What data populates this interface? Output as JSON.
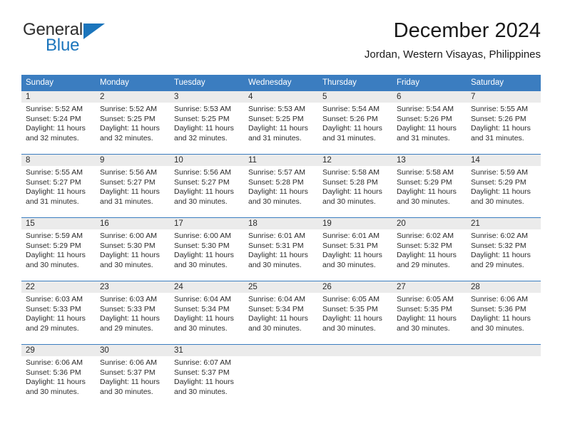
{
  "brand": {
    "name_part1": "General",
    "name_part2": "Blue",
    "accent_color": "#1b75bc"
  },
  "header": {
    "month_title": "December 2024",
    "location": "Jordan, Western Visayas, Philippines"
  },
  "calendar": {
    "header_bg": "#3b7dc0",
    "daynum_band_bg": "#ebebeb",
    "weekday_headers": [
      "Sunday",
      "Monday",
      "Tuesday",
      "Wednesday",
      "Thursday",
      "Friday",
      "Saturday"
    ],
    "weeks": [
      [
        {
          "day": "1",
          "sunrise": "Sunrise: 5:52 AM",
          "sunset": "Sunset: 5:24 PM",
          "daylight_line1": "Daylight: 11 hours",
          "daylight_line2": "and 32 minutes."
        },
        {
          "day": "2",
          "sunrise": "Sunrise: 5:52 AM",
          "sunset": "Sunset: 5:25 PM",
          "daylight_line1": "Daylight: 11 hours",
          "daylight_line2": "and 32 minutes."
        },
        {
          "day": "3",
          "sunrise": "Sunrise: 5:53 AM",
          "sunset": "Sunset: 5:25 PM",
          "daylight_line1": "Daylight: 11 hours",
          "daylight_line2": "and 32 minutes."
        },
        {
          "day": "4",
          "sunrise": "Sunrise: 5:53 AM",
          "sunset": "Sunset: 5:25 PM",
          "daylight_line1": "Daylight: 11 hours",
          "daylight_line2": "and 31 minutes."
        },
        {
          "day": "5",
          "sunrise": "Sunrise: 5:54 AM",
          "sunset": "Sunset: 5:26 PM",
          "daylight_line1": "Daylight: 11 hours",
          "daylight_line2": "and 31 minutes."
        },
        {
          "day": "6",
          "sunrise": "Sunrise: 5:54 AM",
          "sunset": "Sunset: 5:26 PM",
          "daylight_line1": "Daylight: 11 hours",
          "daylight_line2": "and 31 minutes."
        },
        {
          "day": "7",
          "sunrise": "Sunrise: 5:55 AM",
          "sunset": "Sunset: 5:26 PM",
          "daylight_line1": "Daylight: 11 hours",
          "daylight_line2": "and 31 minutes."
        }
      ],
      [
        {
          "day": "8",
          "sunrise": "Sunrise: 5:55 AM",
          "sunset": "Sunset: 5:27 PM",
          "daylight_line1": "Daylight: 11 hours",
          "daylight_line2": "and 31 minutes."
        },
        {
          "day": "9",
          "sunrise": "Sunrise: 5:56 AM",
          "sunset": "Sunset: 5:27 PM",
          "daylight_line1": "Daylight: 11 hours",
          "daylight_line2": "and 31 minutes."
        },
        {
          "day": "10",
          "sunrise": "Sunrise: 5:56 AM",
          "sunset": "Sunset: 5:27 PM",
          "daylight_line1": "Daylight: 11 hours",
          "daylight_line2": "and 30 minutes."
        },
        {
          "day": "11",
          "sunrise": "Sunrise: 5:57 AM",
          "sunset": "Sunset: 5:28 PM",
          "daylight_line1": "Daylight: 11 hours",
          "daylight_line2": "and 30 minutes."
        },
        {
          "day": "12",
          "sunrise": "Sunrise: 5:58 AM",
          "sunset": "Sunset: 5:28 PM",
          "daylight_line1": "Daylight: 11 hours",
          "daylight_line2": "and 30 minutes."
        },
        {
          "day": "13",
          "sunrise": "Sunrise: 5:58 AM",
          "sunset": "Sunset: 5:29 PM",
          "daylight_line1": "Daylight: 11 hours",
          "daylight_line2": "and 30 minutes."
        },
        {
          "day": "14",
          "sunrise": "Sunrise: 5:59 AM",
          "sunset": "Sunset: 5:29 PM",
          "daylight_line1": "Daylight: 11 hours",
          "daylight_line2": "and 30 minutes."
        }
      ],
      [
        {
          "day": "15",
          "sunrise": "Sunrise: 5:59 AM",
          "sunset": "Sunset: 5:29 PM",
          "daylight_line1": "Daylight: 11 hours",
          "daylight_line2": "and 30 minutes."
        },
        {
          "day": "16",
          "sunrise": "Sunrise: 6:00 AM",
          "sunset": "Sunset: 5:30 PM",
          "daylight_line1": "Daylight: 11 hours",
          "daylight_line2": "and 30 minutes."
        },
        {
          "day": "17",
          "sunrise": "Sunrise: 6:00 AM",
          "sunset": "Sunset: 5:30 PM",
          "daylight_line1": "Daylight: 11 hours",
          "daylight_line2": "and 30 minutes."
        },
        {
          "day": "18",
          "sunrise": "Sunrise: 6:01 AM",
          "sunset": "Sunset: 5:31 PM",
          "daylight_line1": "Daylight: 11 hours",
          "daylight_line2": "and 30 minutes."
        },
        {
          "day": "19",
          "sunrise": "Sunrise: 6:01 AM",
          "sunset": "Sunset: 5:31 PM",
          "daylight_line1": "Daylight: 11 hours",
          "daylight_line2": "and 30 minutes."
        },
        {
          "day": "20",
          "sunrise": "Sunrise: 6:02 AM",
          "sunset": "Sunset: 5:32 PM",
          "daylight_line1": "Daylight: 11 hours",
          "daylight_line2": "and 29 minutes."
        },
        {
          "day": "21",
          "sunrise": "Sunrise: 6:02 AM",
          "sunset": "Sunset: 5:32 PM",
          "daylight_line1": "Daylight: 11 hours",
          "daylight_line2": "and 29 minutes."
        }
      ],
      [
        {
          "day": "22",
          "sunrise": "Sunrise: 6:03 AM",
          "sunset": "Sunset: 5:33 PM",
          "daylight_line1": "Daylight: 11 hours",
          "daylight_line2": "and 29 minutes."
        },
        {
          "day": "23",
          "sunrise": "Sunrise: 6:03 AM",
          "sunset": "Sunset: 5:33 PM",
          "daylight_line1": "Daylight: 11 hours",
          "daylight_line2": "and 29 minutes."
        },
        {
          "day": "24",
          "sunrise": "Sunrise: 6:04 AM",
          "sunset": "Sunset: 5:34 PM",
          "daylight_line1": "Daylight: 11 hours",
          "daylight_line2": "and 30 minutes."
        },
        {
          "day": "25",
          "sunrise": "Sunrise: 6:04 AM",
          "sunset": "Sunset: 5:34 PM",
          "daylight_line1": "Daylight: 11 hours",
          "daylight_line2": "and 30 minutes."
        },
        {
          "day": "26",
          "sunrise": "Sunrise: 6:05 AM",
          "sunset": "Sunset: 5:35 PM",
          "daylight_line1": "Daylight: 11 hours",
          "daylight_line2": "and 30 minutes."
        },
        {
          "day": "27",
          "sunrise": "Sunrise: 6:05 AM",
          "sunset": "Sunset: 5:35 PM",
          "daylight_line1": "Daylight: 11 hours",
          "daylight_line2": "and 30 minutes."
        },
        {
          "day": "28",
          "sunrise": "Sunrise: 6:06 AM",
          "sunset": "Sunset: 5:36 PM",
          "daylight_line1": "Daylight: 11 hours",
          "daylight_line2": "and 30 minutes."
        }
      ],
      [
        {
          "day": "29",
          "sunrise": "Sunrise: 6:06 AM",
          "sunset": "Sunset: 5:36 PM",
          "daylight_line1": "Daylight: 11 hours",
          "daylight_line2": "and 30 minutes."
        },
        {
          "day": "30",
          "sunrise": "Sunrise: 6:06 AM",
          "sunset": "Sunset: 5:37 PM",
          "daylight_line1": "Daylight: 11 hours",
          "daylight_line2": "and 30 minutes."
        },
        {
          "day": "31",
          "sunrise": "Sunrise: 6:07 AM",
          "sunset": "Sunset: 5:37 PM",
          "daylight_line1": "Daylight: 11 hours",
          "daylight_line2": "and 30 minutes."
        },
        {
          "day": "",
          "sunrise": "",
          "sunset": "",
          "daylight_line1": "",
          "daylight_line2": ""
        },
        {
          "day": "",
          "sunrise": "",
          "sunset": "",
          "daylight_line1": "",
          "daylight_line2": ""
        },
        {
          "day": "",
          "sunrise": "",
          "sunset": "",
          "daylight_line1": "",
          "daylight_line2": ""
        },
        {
          "day": "",
          "sunrise": "",
          "sunset": "",
          "daylight_line1": "",
          "daylight_line2": ""
        }
      ]
    ]
  }
}
